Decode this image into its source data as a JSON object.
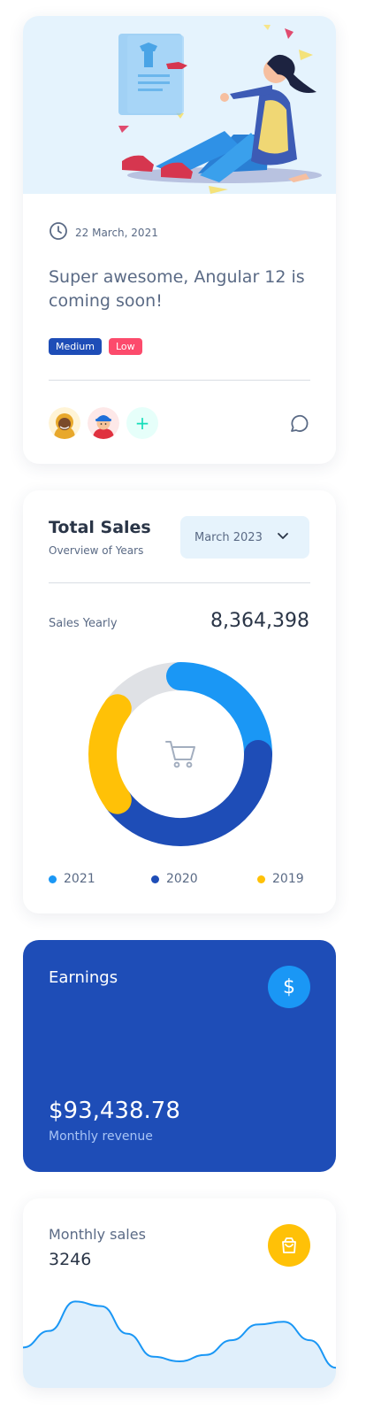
{
  "blog_card": {
    "date": "22 March, 2021",
    "title": "Super awesome, Angular 12 is coming soon!",
    "tags": [
      {
        "label": "Medium",
        "color": "#1e4db7"
      },
      {
        "label": "Low",
        "color": "#fc4b6c"
      }
    ],
    "add_label": "+",
    "icons": [
      "clock-icon",
      "comment-icon"
    ]
  },
  "sales_card": {
    "title": "Total Sales",
    "subtitle": "Overview of Years",
    "month_select": "March 2023",
    "yearly_label": "Sales Yearly",
    "yearly_value": "8,364,398",
    "legend": [
      {
        "label": "2021",
        "color": "#1a97f5"
      },
      {
        "label": "2020",
        "color": "#1e4db7"
      },
      {
        "label": "2019",
        "color": "#ffc107"
      }
    ]
  },
  "earnings_card": {
    "title": "Earnings",
    "icon_symbol": "$",
    "value": "$93,438.78",
    "subtitle": "Monthly revenue",
    "background": "#1e4db7"
  },
  "monthly_card": {
    "label": "Monthly sales",
    "value": "3246",
    "icon": "shopping-bag-icon",
    "icon_bg": "#ffc107"
  },
  "chart_data": [
    {
      "type": "pie",
      "variant": "donut",
      "labels": [
        "2021",
        "2020",
        "2019",
        "Other"
      ],
      "values": [
        25,
        40,
        20,
        15
      ],
      "colors": [
        "#1a97f5",
        "#1e4db7",
        "#ffc107",
        "#dfe1e5"
      ],
      "center_icon": "cart-icon"
    },
    {
      "type": "area",
      "values": [
        40,
        58,
        90,
        85,
        55,
        30,
        25,
        32,
        48,
        65,
        68,
        48,
        18
      ],
      "color": "#1a97f5",
      "fill": "#e0effb"
    }
  ]
}
